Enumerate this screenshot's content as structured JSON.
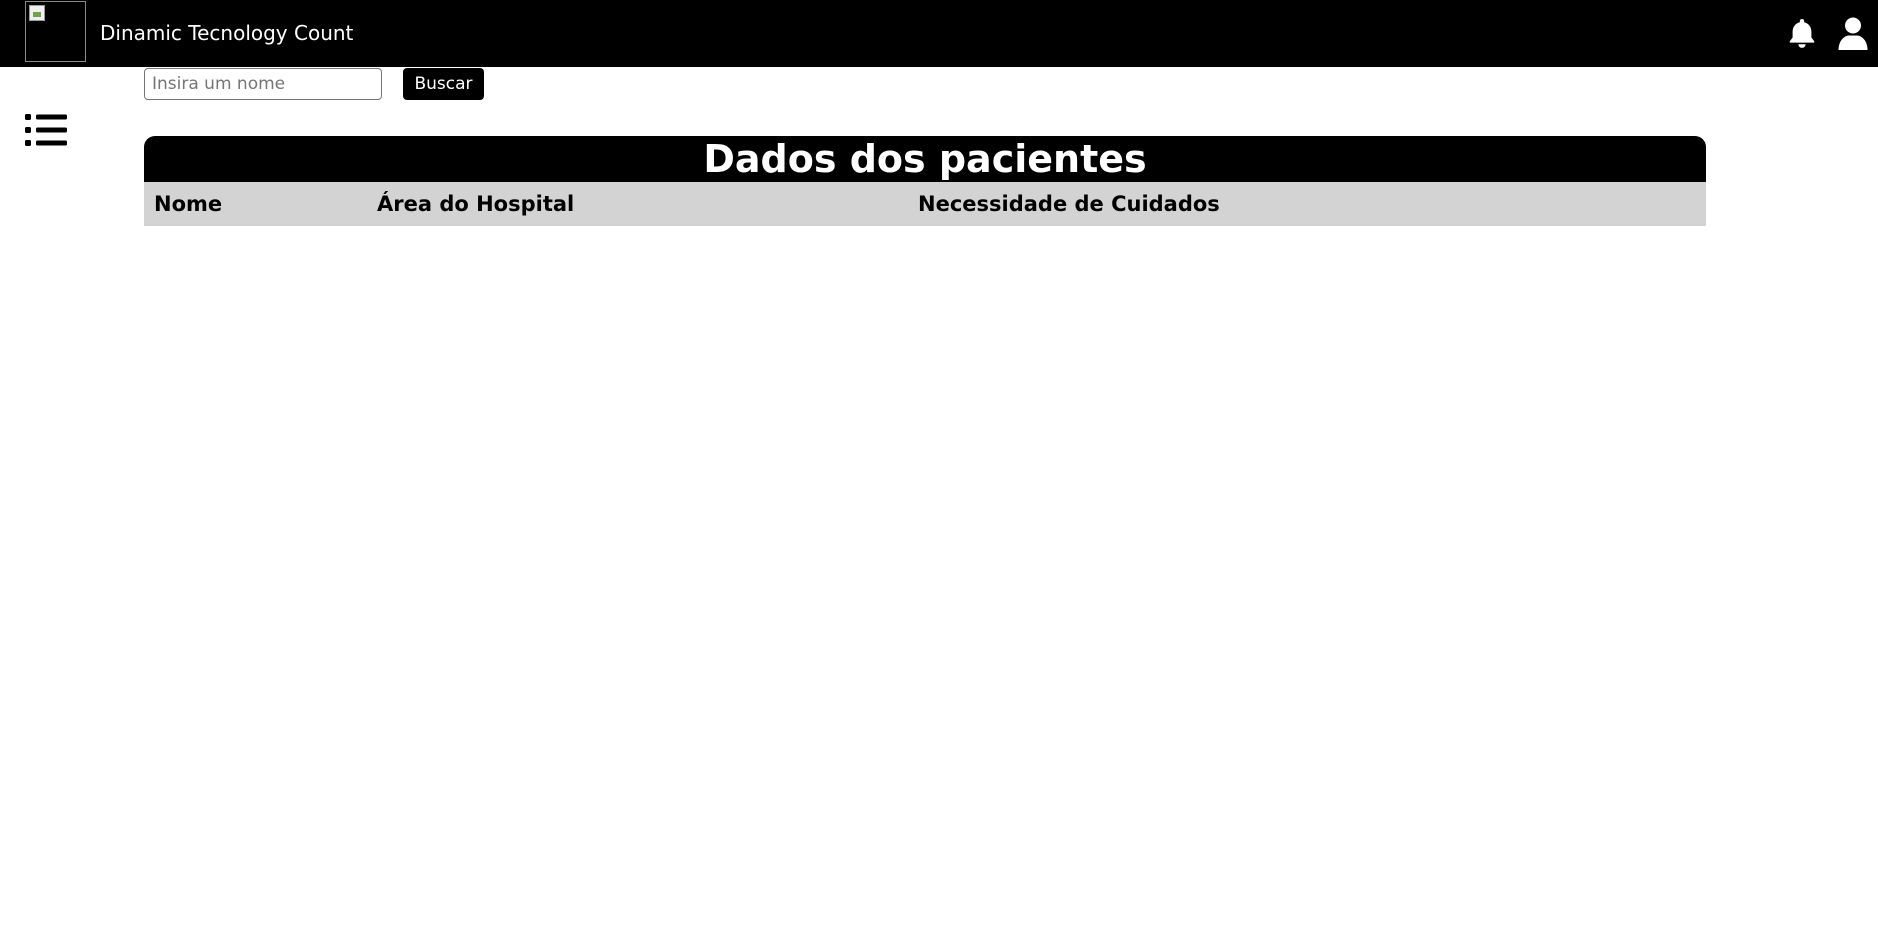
{
  "header": {
    "app_title": "Dinamic Tecnology Count",
    "logo_icon": "broken-image-icon",
    "notification_icon": "bell-icon",
    "profile_icon": "user-icon"
  },
  "sidebar": {
    "menu_icon": "list-icon"
  },
  "search": {
    "placeholder": "Insira um nome",
    "value": "",
    "button_label": "Buscar"
  },
  "table": {
    "title": "Dados dos pacientes",
    "columns": [
      "Nome",
      "Área do Hospital",
      "Necessidade de Cuidados"
    ],
    "rows": []
  },
  "colors": {
    "header_bg": "#000000",
    "table_header_bg": "#d3d3d3",
    "accent": "#000000"
  }
}
